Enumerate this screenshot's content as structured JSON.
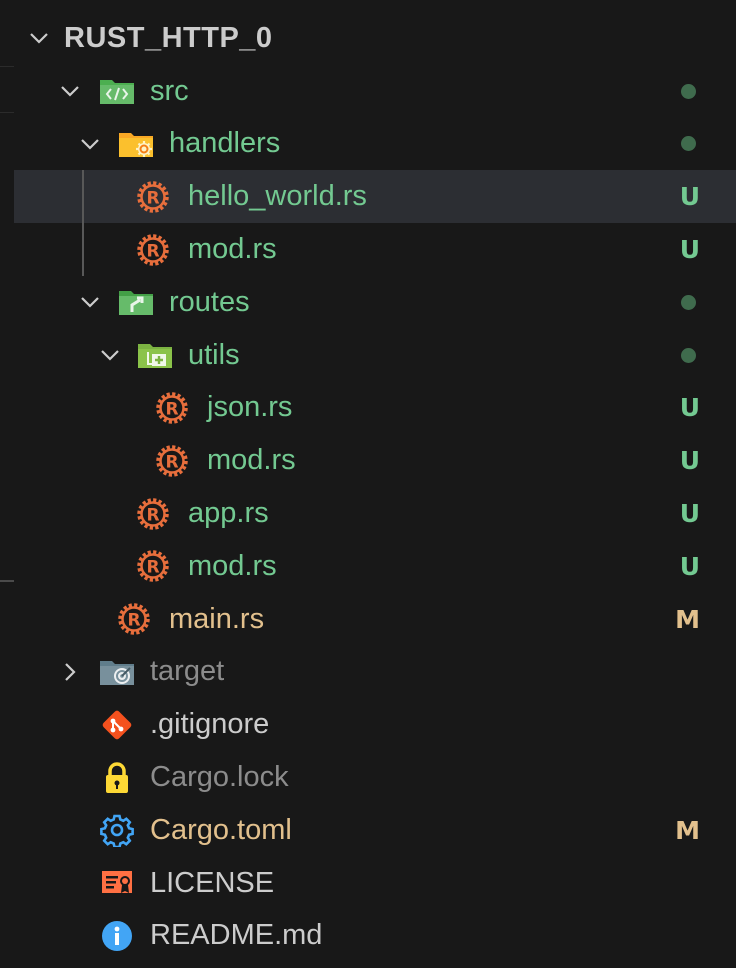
{
  "explorer": {
    "root_label": "RUST_HTTP_0"
  },
  "tree": {
    "src": {
      "label": "src",
      "icon": "src-folder-icon"
    },
    "handlers": {
      "label": "handlers",
      "icon": "config-folder-icon"
    },
    "hello_world": {
      "label": "hello_world.rs",
      "status": "U",
      "icon": "rust-file-icon"
    },
    "handlers_mod": {
      "label": "mod.rs",
      "status": "U",
      "icon": "rust-file-icon"
    },
    "routes": {
      "label": "routes",
      "icon": "routes-folder-icon"
    },
    "utils": {
      "label": "utils",
      "icon": "utils-folder-icon"
    },
    "json": {
      "label": "json.rs",
      "status": "U",
      "icon": "rust-file-icon"
    },
    "utils_mod": {
      "label": "mod.rs",
      "status": "U",
      "icon": "rust-file-icon"
    },
    "app": {
      "label": "app.rs",
      "status": "U",
      "icon": "rust-file-icon"
    },
    "routes_mod": {
      "label": "mod.rs",
      "status": "U",
      "icon": "rust-file-icon"
    },
    "main": {
      "label": "main.rs",
      "status": "M",
      "icon": "rust-file-icon"
    },
    "target": {
      "label": "target",
      "icon": "target-folder-icon"
    },
    "gitignore": {
      "label": ".gitignore",
      "icon": "git-icon"
    },
    "cargo_lock": {
      "label": "Cargo.lock",
      "icon": "lock-icon"
    },
    "cargo_toml": {
      "label": "Cargo.toml",
      "status": "M",
      "icon": "gear-icon"
    },
    "license": {
      "label": "LICENSE",
      "icon": "license-icon"
    },
    "readme": {
      "label": "README.md",
      "icon": "info-icon"
    }
  },
  "colors": {
    "untracked": "#73c991",
    "modified": "#e2c08d",
    "ignored": "#8c8c8c",
    "dot": "#3f6b4d",
    "selection": "#2c2e33",
    "rust": "#e76e3c"
  }
}
